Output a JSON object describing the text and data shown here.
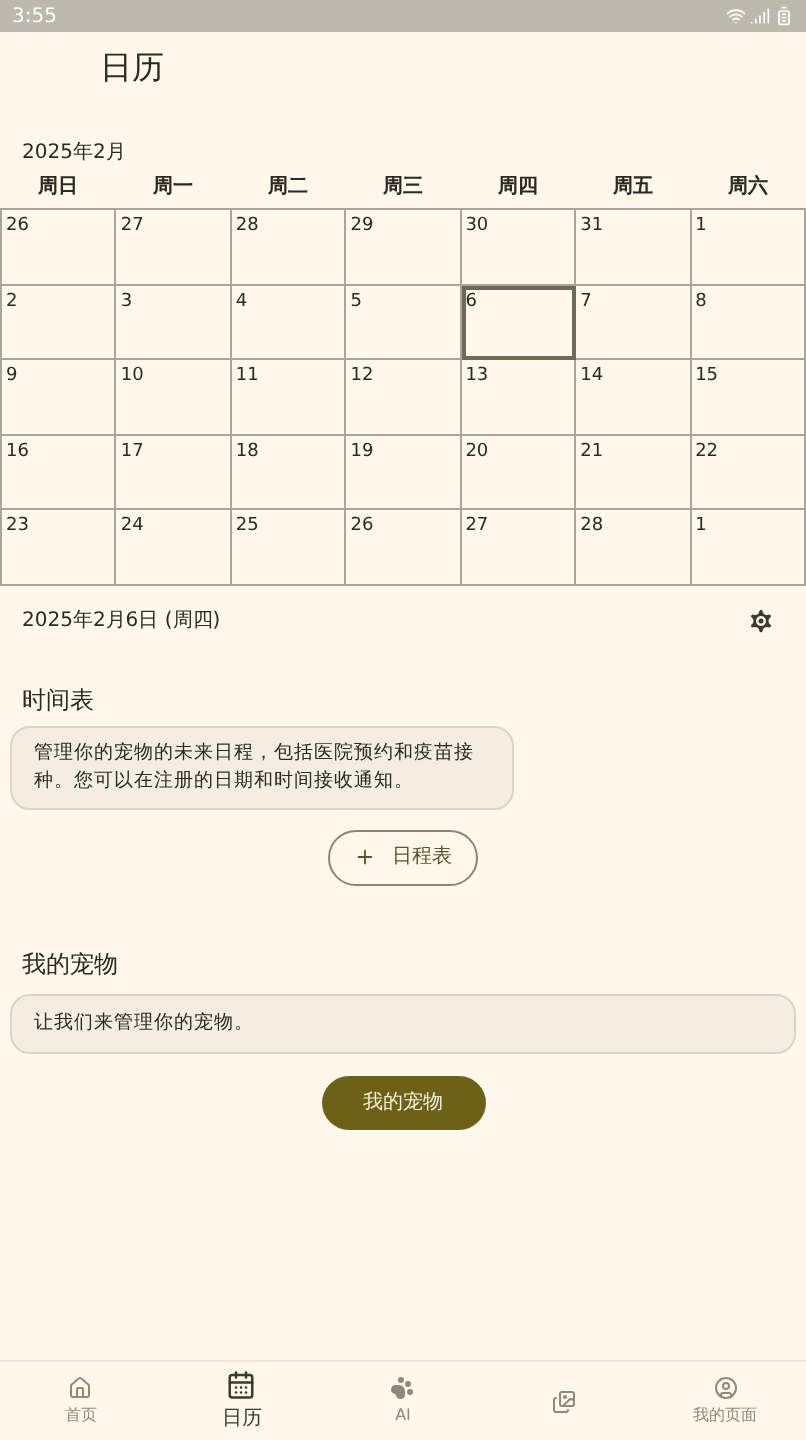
{
  "status_bar": {
    "time": "3:55"
  },
  "header": {
    "title": "日历"
  },
  "calendar": {
    "month": "2025年2月",
    "weekdays": [
      "周日",
      "周一",
      "周二",
      "周三",
      "周四",
      "周五",
      "周六"
    ],
    "weeks": [
      [
        {
          "day": "26",
          "selected": false
        },
        {
          "day": "27",
          "selected": false
        },
        {
          "day": "28",
          "selected": false
        },
        {
          "day": "29",
          "selected": false
        },
        {
          "day": "30",
          "selected": false
        },
        {
          "day": "31",
          "selected": false
        },
        {
          "day": "1",
          "selected": false
        }
      ],
      [
        {
          "day": "2",
          "selected": false
        },
        {
          "day": "3",
          "selected": false
        },
        {
          "day": "4",
          "selected": false
        },
        {
          "day": "5",
          "selected": false
        },
        {
          "day": "6",
          "selected": true
        },
        {
          "day": "7",
          "selected": false
        },
        {
          "day": "8",
          "selected": false
        }
      ],
      [
        {
          "day": "9",
          "selected": false
        },
        {
          "day": "10",
          "selected": false
        },
        {
          "day": "11",
          "selected": false
        },
        {
          "day": "12",
          "selected": false
        },
        {
          "day": "13",
          "selected": false
        },
        {
          "day": "14",
          "selected": false
        },
        {
          "day": "15",
          "selected": false
        }
      ],
      [
        {
          "day": "16",
          "selected": false
        },
        {
          "day": "17",
          "selected": false
        },
        {
          "day": "18",
          "selected": false
        },
        {
          "day": "19",
          "selected": false
        },
        {
          "day": "20",
          "selected": false
        },
        {
          "day": "21",
          "selected": false
        },
        {
          "day": "22",
          "selected": false
        }
      ],
      [
        {
          "day": "23",
          "selected": false
        },
        {
          "day": "24",
          "selected": false
        },
        {
          "day": "25",
          "selected": false
        },
        {
          "day": "26",
          "selected": false
        },
        {
          "day": "27",
          "selected": false
        },
        {
          "day": "28",
          "selected": false
        },
        {
          "day": "1",
          "selected": false
        }
      ]
    ]
  },
  "selected_date": "2025年2月6日 (周四)",
  "schedule": {
    "heading": "时间表",
    "note": "管理你的宠物的未来日程，包括医院预约和疫苗接种。您可以在注册的日期和时间接收通知。",
    "button": "日程表"
  },
  "pets": {
    "heading": "我的宠物",
    "note": "让我们来管理你的宠物。",
    "button": "我的宠物"
  },
  "bottom_nav": [
    {
      "kind": "home",
      "label": "首页",
      "selected": false
    },
    {
      "kind": "calendar",
      "label": "日历",
      "selected": true
    },
    {
      "kind": "paw",
      "label": "AI",
      "selected": false
    },
    {
      "kind": "gallery",
      "selected": false
    },
    {
      "kind": "person",
      "label": "我的页面",
      "selected": false
    }
  ]
}
